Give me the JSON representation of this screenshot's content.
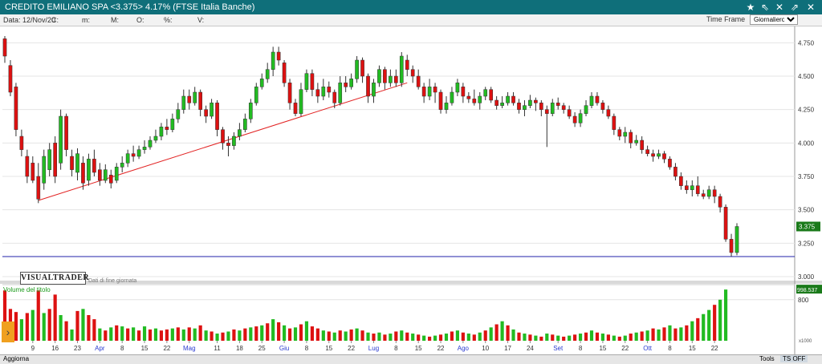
{
  "window": {
    "title": "CREDITO EMILIANO SPA <3.375> 4.17%  (FTSE Italia Banche)",
    "controls": [
      "★",
      "⇖",
      "✕",
      "⇗",
      "✕"
    ]
  },
  "infobar": {
    "date_label": "Data: 12/Nov/20",
    "c_label": "C:",
    "m_label": "m:",
    "M_label": "M:",
    "o_label": "O:",
    "pct_label": "%:",
    "v_label": "V:",
    "timeframe_label": "Time Frame",
    "timeframe_value": "Giornaliero"
  },
  "chart_data": {
    "type": "candlestick",
    "price_axis": {
      "range": [
        3.0,
        4.8
      ],
      "ticks": [
        "4.750",
        "4.500",
        "4.250",
        "4.000",
        "3.750",
        "3.500",
        "3.250",
        "3.000"
      ],
      "tick_values": [
        4.75,
        4.5,
        4.25,
        4.0,
        3.75,
        3.5,
        3.25,
        3.0
      ]
    },
    "last_price": "3.375",
    "volume_label": "Volume del titolo",
    "volume_axis_label": "800",
    "volume_badge": "998.537",
    "volume_unit": "x1000",
    "x_ticks": [
      "9",
      "16",
      "23",
      "Apr",
      "8",
      "15",
      "22",
      "Mag",
      "11",
      "18",
      "25",
      "Giu",
      "8",
      "15",
      "22",
      "Lug",
      "8",
      "15",
      "22",
      "Ago",
      "10",
      "17",
      "24",
      "Set",
      "8",
      "15",
      "22",
      "Ott",
      "8",
      "15",
      "22"
    ],
    "month_ticks": [
      "Apr",
      "Mag",
      "Giu",
      "Lug",
      "Ago",
      "Set",
      "Ott"
    ],
    "colors": {
      "up": "#22bb22",
      "down": "#dd1111",
      "trendline": "#e22222",
      "hline": "#2222aa"
    },
    "candles": [
      [
        4.78,
        4.65,
        4.8,
        4.6
      ],
      [
        4.58,
        4.38,
        4.62,
        4.35
      ],
      [
        4.42,
        4.1,
        4.45,
        4.05
      ],
      [
        4.05,
        3.95,
        4.1,
        3.9
      ],
      [
        3.9,
        3.75,
        3.95,
        3.7
      ],
      [
        3.85,
        3.72,
        3.9,
        3.7
      ],
      [
        3.75,
        3.58,
        3.85,
        3.55
      ],
      [
        3.7,
        3.9,
        3.95,
        3.65
      ],
      [
        3.8,
        3.95,
        4.0,
        3.75
      ],
      [
        4.0,
        3.75,
        4.05,
        3.7
      ],
      [
        3.85,
        4.2,
        4.25,
        3.8
      ],
      [
        4.2,
        3.95,
        4.22,
        3.9
      ],
      [
        3.9,
        3.8,
        3.95,
        3.75
      ],
      [
        3.78,
        3.92,
        3.96,
        3.72
      ],
      [
        3.85,
        3.7,
        3.9,
        3.65
      ],
      [
        3.72,
        3.88,
        3.92,
        3.68
      ],
      [
        3.88,
        3.78,
        3.95,
        3.75
      ],
      [
        3.8,
        3.72,
        3.85,
        3.68
      ],
      [
        3.72,
        3.8,
        3.84,
        3.7
      ],
      [
        3.76,
        3.7,
        3.8,
        3.66
      ],
      [
        3.72,
        3.82,
        3.85,
        3.7
      ],
      [
        3.82,
        3.85,
        3.9,
        3.78
      ],
      [
        3.85,
        3.92,
        3.95,
        3.82
      ],
      [
        3.92,
        3.9,
        3.98,
        3.86
      ],
      [
        3.9,
        3.95,
        3.98,
        3.88
      ],
      [
        3.95,
        3.97,
        4.02,
        3.92
      ],
      [
        3.97,
        4.02,
        4.05,
        3.95
      ],
      [
        4.02,
        4.05,
        4.1,
        4.0
      ],
      [
        4.05,
        4.12,
        4.15,
        4.02
      ],
      [
        4.12,
        4.1,
        4.18,
        4.06
      ],
      [
        4.1,
        4.18,
        4.22,
        4.08
      ],
      [
        4.18,
        4.25,
        4.3,
        4.15
      ],
      [
        4.25,
        4.35,
        4.4,
        4.22
      ],
      [
        4.35,
        4.3,
        4.4,
        4.25
      ],
      [
        4.3,
        4.38,
        4.42,
        4.28
      ],
      [
        4.38,
        4.25,
        4.4,
        4.2
      ],
      [
        4.25,
        4.2,
        4.28,
        4.15
      ],
      [
        4.2,
        4.3,
        4.33,
        4.18
      ],
      [
        4.3,
        4.1,
        4.32,
        4.05
      ],
      [
        4.1,
        4.0,
        4.12,
        3.95
      ],
      [
        4.0,
        3.98,
        4.05,
        3.9
      ],
      [
        3.98,
        4.05,
        4.08,
        3.95
      ],
      [
        4.05,
        4.1,
        4.15,
        4.02
      ],
      [
        4.1,
        4.18,
        4.22,
        4.08
      ],
      [
        4.18,
        4.3,
        4.33,
        4.15
      ],
      [
        4.3,
        4.42,
        4.45,
        4.28
      ],
      [
        4.42,
        4.48,
        4.52,
        4.4
      ],
      [
        4.48,
        4.55,
        4.6,
        4.45
      ],
      [
        4.55,
        4.68,
        4.72,
        4.5
      ],
      [
        4.68,
        4.62,
        4.72,
        4.58
      ],
      [
        4.6,
        4.45,
        4.62,
        4.42
      ],
      [
        4.45,
        4.3,
        4.48,
        4.25
      ],
      [
        4.3,
        4.22,
        4.33,
        4.2
      ],
      [
        4.22,
        4.4,
        4.45,
        4.2
      ],
      [
        4.4,
        4.52,
        4.55,
        4.38
      ],
      [
        4.52,
        4.4,
        4.55,
        4.35
      ],
      [
        4.4,
        4.35,
        4.45,
        4.3
      ],
      [
        4.35,
        4.42,
        4.48,
        4.32
      ],
      [
        4.42,
        4.38,
        4.46,
        4.34
      ],
      [
        4.38,
        4.3,
        4.4,
        4.26
      ],
      [
        4.3,
        4.45,
        4.5,
        4.28
      ],
      [
        4.45,
        4.42,
        4.5,
        4.38
      ],
      [
        4.42,
        4.48,
        4.52,
        4.4
      ],
      [
        4.48,
        4.62,
        4.65,
        4.45
      ],
      [
        4.62,
        4.5,
        4.64,
        4.45
      ],
      [
        4.5,
        4.35,
        4.52,
        4.3
      ],
      [
        4.35,
        4.45,
        4.48,
        4.3
      ],
      [
        4.45,
        4.55,
        4.58,
        4.42
      ],
      [
        4.55,
        4.45,
        4.57,
        4.4
      ],
      [
        4.45,
        4.5,
        4.55,
        4.42
      ],
      [
        4.5,
        4.45,
        4.55,
        4.42
      ],
      [
        4.45,
        4.65,
        4.68,
        4.42
      ],
      [
        4.62,
        4.55,
        4.66,
        4.5
      ],
      [
        4.55,
        4.5,
        4.58,
        4.45
      ],
      [
        4.5,
        4.42,
        4.55,
        4.4
      ],
      [
        4.42,
        4.35,
        4.45,
        4.3
      ],
      [
        4.35,
        4.42,
        4.48,
        4.32
      ],
      [
        4.42,
        4.38,
        4.45,
        4.3
      ],
      [
        4.38,
        4.25,
        4.4,
        4.22
      ],
      [
        4.25,
        4.3,
        4.35,
        4.22
      ],
      [
        4.3,
        4.38,
        4.42,
        4.28
      ],
      [
        4.38,
        4.45,
        4.48,
        4.35
      ],
      [
        4.42,
        4.35,
        4.45,
        4.3
      ],
      [
        4.35,
        4.33,
        4.38,
        4.3
      ],
      [
        4.33,
        4.3,
        4.4,
        4.28
      ],
      [
        4.3,
        4.35,
        4.38,
        4.25
      ],
      [
        4.35,
        4.4,
        4.42,
        4.32
      ],
      [
        4.4,
        4.32,
        4.42,
        4.3
      ],
      [
        4.32,
        4.28,
        4.35,
        4.25
      ],
      [
        4.28,
        4.3,
        4.35,
        4.26
      ],
      [
        4.3,
        4.35,
        4.38,
        4.28
      ],
      [
        4.35,
        4.3,
        4.38,
        4.28
      ],
      [
        4.3,
        4.25,
        4.33,
        4.22
      ],
      [
        4.25,
        4.28,
        4.32,
        4.2
      ],
      [
        4.28,
        4.32,
        4.36,
        4.26
      ],
      [
        4.32,
        4.3,
        4.34,
        4.24
      ],
      [
        4.3,
        4.25,
        4.32,
        4.2
      ],
      [
        4.25,
        4.22,
        4.28,
        3.97
      ],
      [
        4.22,
        4.3,
        4.33,
        4.2
      ],
      [
        4.3,
        4.28,
        4.34,
        4.25
      ],
      [
        4.28,
        4.25,
        4.3,
        4.22
      ],
      [
        4.25,
        4.2,
        4.28,
        4.18
      ],
      [
        4.2,
        4.15,
        4.23,
        4.12
      ],
      [
        4.15,
        4.22,
        4.25,
        4.12
      ],
      [
        4.22,
        4.28,
        4.32,
        4.2
      ],
      [
        4.28,
        4.35,
        4.38,
        4.26
      ],
      [
        4.35,
        4.3,
        4.38,
        4.28
      ],
      [
        4.3,
        4.25,
        4.32,
        4.22
      ],
      [
        4.25,
        4.2,
        4.28,
        4.18
      ],
      [
        4.2,
        4.1,
        4.22,
        4.06
      ],
      [
        4.1,
        4.05,
        4.12,
        4.02
      ],
      [
        4.05,
        4.08,
        4.12,
        4.0
      ],
      [
        4.08,
        4.0,
        4.1,
        3.96
      ],
      [
        4.0,
        4.02,
        4.06,
        3.98
      ],
      [
        4.02,
        3.95,
        4.05,
        3.92
      ],
      [
        3.95,
        3.92,
        3.98,
        3.9
      ],
      [
        3.92,
        3.9,
        3.95,
        3.86
      ],
      [
        3.9,
        3.92,
        3.95,
        3.88
      ],
      [
        3.92,
        3.88,
        3.94,
        3.85
      ],
      [
        3.88,
        3.82,
        3.9,
        3.8
      ],
      [
        3.82,
        3.75,
        3.85,
        3.72
      ],
      [
        3.75,
        3.68,
        3.78,
        3.65
      ],
      [
        3.68,
        3.65,
        3.72,
        3.62
      ],
      [
        3.65,
        3.68,
        3.72,
        3.6
      ],
      [
        3.68,
        3.62,
        3.75,
        3.6
      ],
      [
        3.62,
        3.6,
        3.65,
        3.58
      ],
      [
        3.6,
        3.65,
        3.68,
        3.58
      ],
      [
        3.65,
        3.6,
        3.68,
        3.55
      ],
      [
        3.6,
        3.52,
        3.62,
        3.48
      ],
      [
        3.52,
        3.28,
        3.54,
        3.26
      ],
      [
        3.28,
        3.18,
        3.32,
        3.15
      ],
      [
        3.18,
        3.375,
        3.4,
        3.16
      ]
    ],
    "volumes": [
      [
        980,
        0
      ],
      [
        620,
        0
      ],
      [
        560,
        0
      ],
      [
        420,
        1
      ],
      [
        540,
        0
      ],
      [
        600,
        1
      ],
      [
        980,
        0
      ],
      [
        540,
        1
      ],
      [
        620,
        0
      ],
      [
        900,
        0
      ],
      [
        500,
        1
      ],
      [
        380,
        0
      ],
      [
        220,
        1
      ],
      [
        580,
        0
      ],
      [
        620,
        1
      ],
      [
        500,
        0
      ],
      [
        420,
        0
      ],
      [
        240,
        1
      ],
      [
        200,
        0
      ],
      [
        260,
        1
      ],
      [
        300,
        0
      ],
      [
        280,
        1
      ],
      [
        240,
        0
      ],
      [
        260,
        1
      ],
      [
        200,
        0
      ],
      [
        280,
        1
      ],
      [
        220,
        0
      ],
      [
        240,
        1
      ],
      [
        200,
        0
      ],
      [
        220,
        0
      ],
      [
        240,
        1
      ],
      [
        260,
        0
      ],
      [
        220,
        1
      ],
      [
        260,
        0
      ],
      [
        240,
        1
      ],
      [
        300,
        0
      ],
      [
        200,
        1
      ],
      [
        180,
        0
      ],
      [
        140,
        1
      ],
      [
        160,
        0
      ],
      [
        180,
        1
      ],
      [
        220,
        0
      ],
      [
        200,
        1
      ],
      [
        240,
        0
      ],
      [
        260,
        1
      ],
      [
        280,
        0
      ],
      [
        300,
        1
      ],
      [
        340,
        0
      ],
      [
        420,
        1
      ],
      [
        360,
        0
      ],
      [
        300,
        1
      ],
      [
        240,
        0
      ],
      [
        260,
        1
      ],
      [
        320,
        0
      ],
      [
        380,
        1
      ],
      [
        280,
        0
      ],
      [
        240,
        0
      ],
      [
        200,
        1
      ],
      [
        180,
        0
      ],
      [
        160,
        1
      ],
      [
        200,
        0
      ],
      [
        180,
        1
      ],
      [
        220,
        0
      ],
      [
        240,
        1
      ],
      [
        200,
        0
      ],
      [
        160,
        1
      ],
      [
        140,
        0
      ],
      [
        160,
        1
      ],
      [
        120,
        0
      ],
      [
        140,
        1
      ],
      [
        180,
        0
      ],
      [
        200,
        1
      ],
      [
        160,
        0
      ],
      [
        140,
        1
      ],
      [
        120,
        0
      ],
      [
        100,
        1
      ],
      [
        80,
        0
      ],
      [
        100,
        1
      ],
      [
        120,
        0
      ],
      [
        140,
        1
      ],
      [
        180,
        0
      ],
      [
        200,
        1
      ],
      [
        160,
        0
      ],
      [
        140,
        1
      ],
      [
        120,
        0
      ],
      [
        160,
        1
      ],
      [
        200,
        0
      ],
      [
        260,
        1
      ],
      [
        320,
        0
      ],
      [
        380,
        1
      ],
      [
        300,
        0
      ],
      [
        220,
        1
      ],
      [
        160,
        0
      ],
      [
        140,
        1
      ],
      [
        120,
        0
      ],
      [
        100,
        1
      ],
      [
        80,
        0
      ],
      [
        140,
        1
      ],
      [
        120,
        0
      ],
      [
        100,
        1
      ],
      [
        80,
        0
      ],
      [
        100,
        1
      ],
      [
        120,
        0
      ],
      [
        140,
        1
      ],
      [
        160,
        0
      ],
      [
        200,
        1
      ],
      [
        160,
        0
      ],
      [
        140,
        1
      ],
      [
        120,
        0
      ],
      [
        100,
        1
      ],
      [
        80,
        0
      ],
      [
        100,
        1
      ],
      [
        140,
        0
      ],
      [
        160,
        1
      ],
      [
        180,
        0
      ],
      [
        200,
        1
      ],
      [
        240,
        0
      ],
      [
        220,
        1
      ],
      [
        260,
        0
      ],
      [
        300,
        1
      ],
      [
        240,
        0
      ],
      [
        260,
        1
      ],
      [
        300,
        0
      ],
      [
        380,
        1
      ],
      [
        440,
        0
      ],
      [
        520,
        1
      ],
      [
        600,
        1
      ],
      [
        700,
        0
      ],
      [
        800,
        1
      ],
      [
        998,
        1
      ]
    ]
  },
  "bottom": {
    "refresh_label": "Aggiorna",
    "tools_label": "Tools",
    "tsoff_label": "TS OFF"
  },
  "logo": {
    "text": "VISUALTRADER",
    "subtitle": "Dati di fine giornata"
  }
}
